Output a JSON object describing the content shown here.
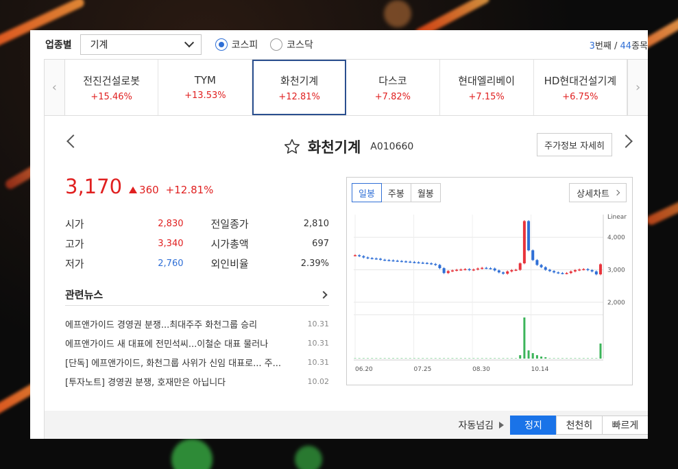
{
  "filter": {
    "label": "업종별",
    "select_value": "기계",
    "market_options": [
      {
        "label": "코스피",
        "checked": true
      },
      {
        "label": "코스닥",
        "checked": false
      }
    ],
    "page_current": "3",
    "page_current_suffix": "번째 / ",
    "page_total": "44",
    "page_total_suffix": "종목"
  },
  "tabs": [
    {
      "name": "전진건설로봇",
      "change": "+15.46%"
    },
    {
      "name": "TYM",
      "change": "+13.53%"
    },
    {
      "name": "화천기계",
      "change": "+12.81%",
      "active": true
    },
    {
      "name": "다스코",
      "change": "+7.82%"
    },
    {
      "name": "현대엘리베이",
      "change": "+7.15%"
    },
    {
      "name": "HD현대건설기계",
      "change": "+6.75%"
    }
  ],
  "stock": {
    "name": "화천기계",
    "code": "A010660",
    "detail_button": "주가정보 자세히",
    "price": "3,170",
    "diff": "360",
    "pct": "+12.81%"
  },
  "stats": [
    {
      "l1": "시가",
      "v1": "2,830",
      "c1": "red",
      "l2": "전일종가",
      "v2": "2,810"
    },
    {
      "l1": "고가",
      "v1": "3,340",
      "c1": "red",
      "l2": "시가총액",
      "v2": "697"
    },
    {
      "l1": "저가",
      "v1": "2,760",
      "c1": "blue",
      "l2": "외인비율",
      "v2": "2.39%"
    }
  ],
  "news": {
    "title": "관련뉴스",
    "items": [
      {
        "text": "에프앤가이드 경영권 분쟁...최대주주 화천그룹 승리",
        "date": "10.31"
      },
      {
        "text": "에프앤가이드 새 대표에 전민석씨...이철순 대표 물러나",
        "date": "10.31"
      },
      {
        "text": "[단독] 에프앤가이드, 화천그룹 사위가 신임 대표로... 주...",
        "date": "10.31"
      },
      {
        "text": "[투자노트] 경영권 분쟁, 호재만은 아닙니다",
        "date": "10.02"
      }
    ]
  },
  "chart": {
    "tabs": [
      "일봉",
      "주봉",
      "월봉"
    ],
    "active_tab": "일봉",
    "detail_button": "상세차트",
    "scale_label": "Linear",
    "up_color": "#e8343c",
    "down_color": "#2f6fd6",
    "volume_color": "#3cb45a"
  },
  "chart_data": {
    "type": "candlestick",
    "x_ticks": [
      "06.20",
      "07.25",
      "08.30",
      "10.14"
    ],
    "y_ticks": [
      "4,000",
      "3,000",
      "2,000"
    ],
    "ylim": [
      1700,
      4700
    ],
    "price_series": [
      3450,
      3420,
      3380,
      3360,
      3350,
      3340,
      3310,
      3300,
      3290,
      3280,
      3270,
      3260,
      3250,
      3240,
      3230,
      3220,
      3210,
      3200,
      3180,
      3150,
      3050,
      2900,
      2960,
      2980,
      3000,
      3010,
      3020,
      2990,
      3010,
      3040,
      3060,
      3050,
      3040,
      2980,
      2920,
      2880,
      2950,
      2990,
      3000,
      3200,
      4500,
      3600,
      3300,
      3150,
      3080,
      3000,
      2960,
      2920,
      2900,
      2890,
      2900,
      2950,
      2990,
      3010,
      3020,
      2990,
      2950,
      2860,
      3170
    ],
    "volume_series": [
      0,
      0,
      0,
      0,
      0,
      0,
      0,
      0,
      0,
      0,
      0,
      0,
      0,
      0,
      0,
      0,
      0,
      0,
      0,
      0,
      0,
      0,
      0,
      0,
      0,
      0,
      0,
      0,
      0,
      0,
      0,
      0,
      0,
      0,
      0,
      0,
      0,
      0,
      0,
      5,
      60,
      12,
      8,
      5,
      3,
      2,
      0,
      0,
      0,
      0,
      0,
      0,
      0,
      0,
      0,
      0,
      0,
      0,
      22
    ]
  },
  "footer": {
    "auto_label": "자동넘김",
    "buttons": [
      {
        "label": "정지",
        "active": true
      },
      {
        "label": "천천히",
        "active": false
      },
      {
        "label": "빠르게",
        "active": false
      }
    ]
  }
}
